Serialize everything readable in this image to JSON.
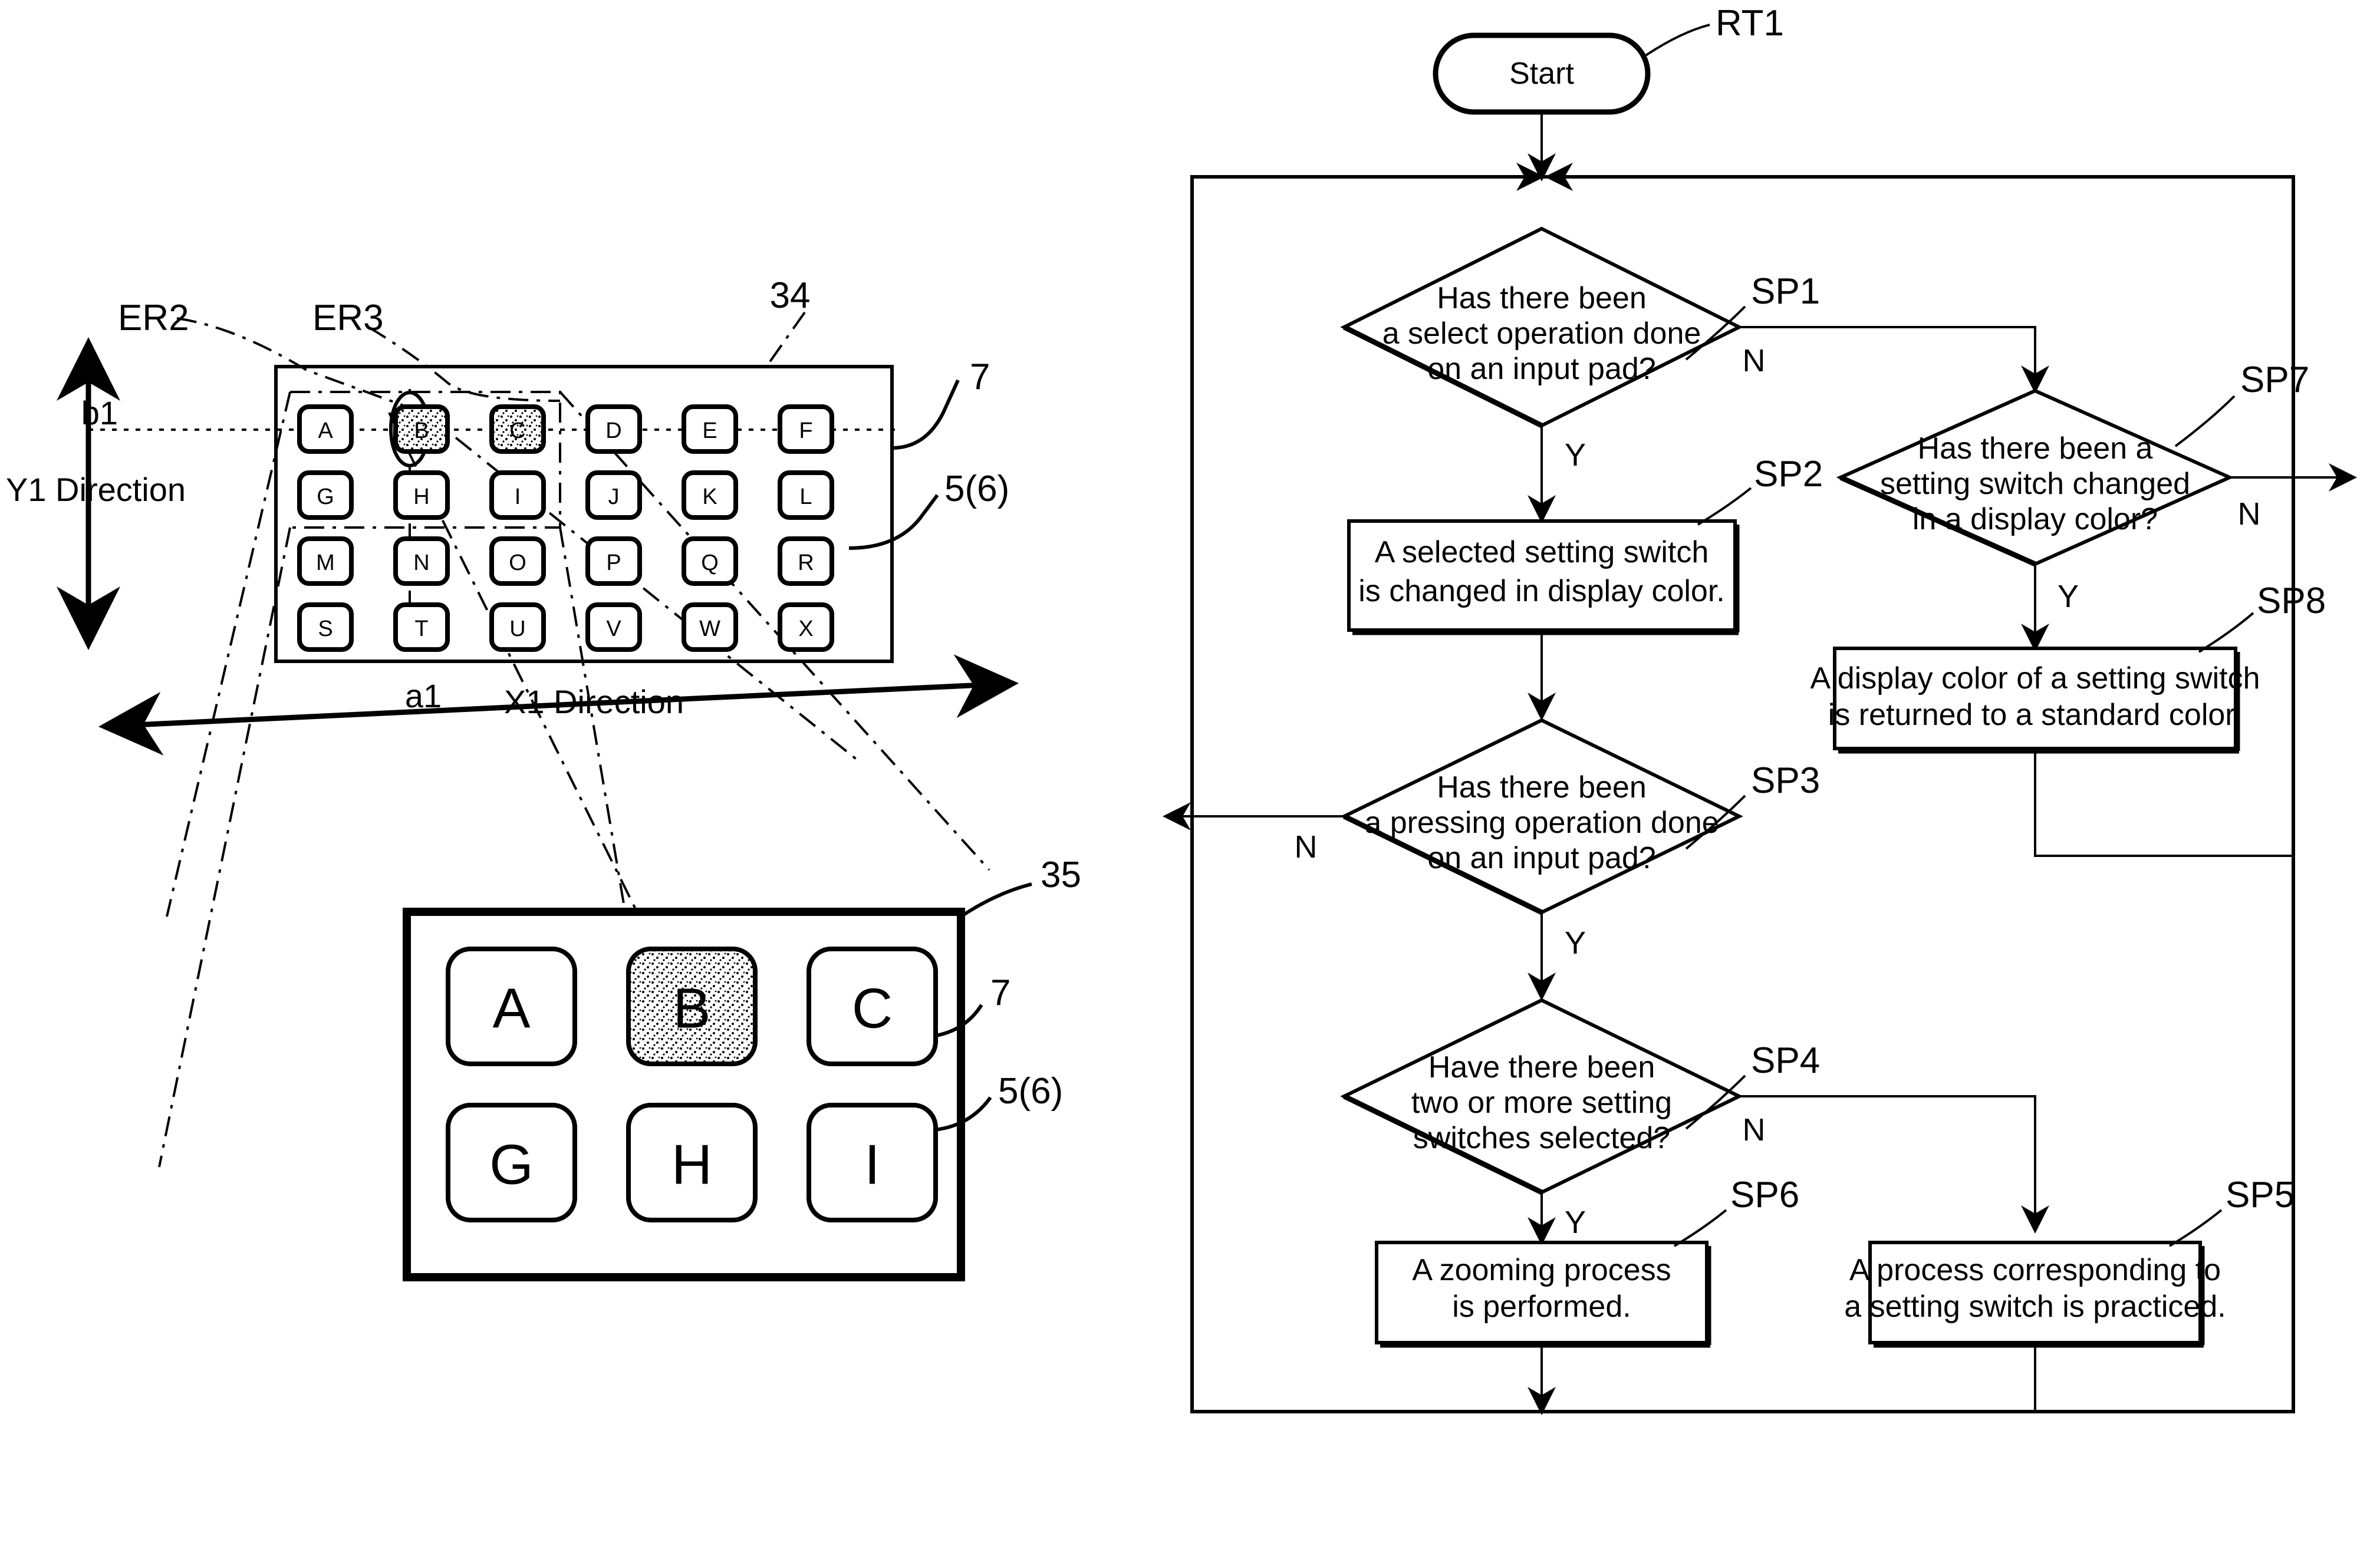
{
  "figure": {
    "left_panel": {
      "name": "input-pad-overview",
      "labels": {
        "er2": "ER2",
        "er3": "ER3",
        "ref_panel": "34",
        "ref_pad": "7",
        "ref_display": "5(6)",
        "dim_b1": "b1",
        "dim_a1": "a1",
        "dir_y": "Y1 Direction",
        "dir_x": "X1 Direction"
      },
      "keypad": {
        "columns": 6,
        "rows": 4,
        "keys": [
          "A",
          "B",
          "C",
          "D",
          "E",
          "F",
          "G",
          "H",
          "I",
          "J",
          "K",
          "L",
          "M",
          "N",
          "O",
          "P",
          "Q",
          "R",
          "S",
          "T",
          "U",
          "V",
          "W",
          "X"
        ],
        "selected_keys": [
          "B",
          "C"
        ]
      }
    },
    "zoom_panel": {
      "name": "zoomed-input-pad",
      "labels": {
        "ref_panel": "35",
        "ref_pad": "7",
        "ref_display": "5(6)"
      },
      "keypad": {
        "columns": 3,
        "rows": 2,
        "keys": [
          "A",
          "B",
          "C",
          "G",
          "H",
          "I"
        ],
        "selected_keys": [
          "B"
        ]
      }
    },
    "flowchart": {
      "name": "processing-routine-flowchart",
      "start": {
        "label": "Start",
        "ref": "RT1"
      },
      "steps": [
        {
          "id": "SP1",
          "ref": "SP1",
          "shape": "decision",
          "lines": [
            "Has there been",
            "a select operation done",
            "on an input pad?"
          ],
          "yes": "Y",
          "no": "N"
        },
        {
          "id": "SP2",
          "ref": "SP2",
          "shape": "process",
          "lines": [
            "A selected setting switch",
            "is changed in display color."
          ]
        },
        {
          "id": "SP3",
          "ref": "SP3",
          "shape": "decision",
          "lines": [
            "Has there been",
            "a pressing operation done",
            "on an input pad?"
          ],
          "yes": "Y",
          "no": "N"
        },
        {
          "id": "SP4",
          "ref": "SP4",
          "shape": "decision",
          "lines": [
            "Have there been",
            "two or more setting",
            "switches selected?"
          ],
          "yes": "Y",
          "no": "N"
        },
        {
          "id": "SP5",
          "ref": "SP5",
          "shape": "process",
          "lines": [
            "A process corresponding to",
            "a setting switch is practiced."
          ]
        },
        {
          "id": "SP6",
          "ref": "SP6",
          "shape": "process",
          "lines": [
            "A zooming process",
            "is performed."
          ]
        },
        {
          "id": "SP7",
          "ref": "SP7",
          "shape": "decision",
          "lines": [
            "Has there been a",
            "setting switch changed",
            "in a display color?"
          ],
          "yes": "Y",
          "no": "N"
        },
        {
          "id": "SP8",
          "ref": "SP8",
          "shape": "process",
          "lines": [
            "A display color of a setting switch",
            "is returned to a standard color."
          ]
        }
      ]
    }
  }
}
